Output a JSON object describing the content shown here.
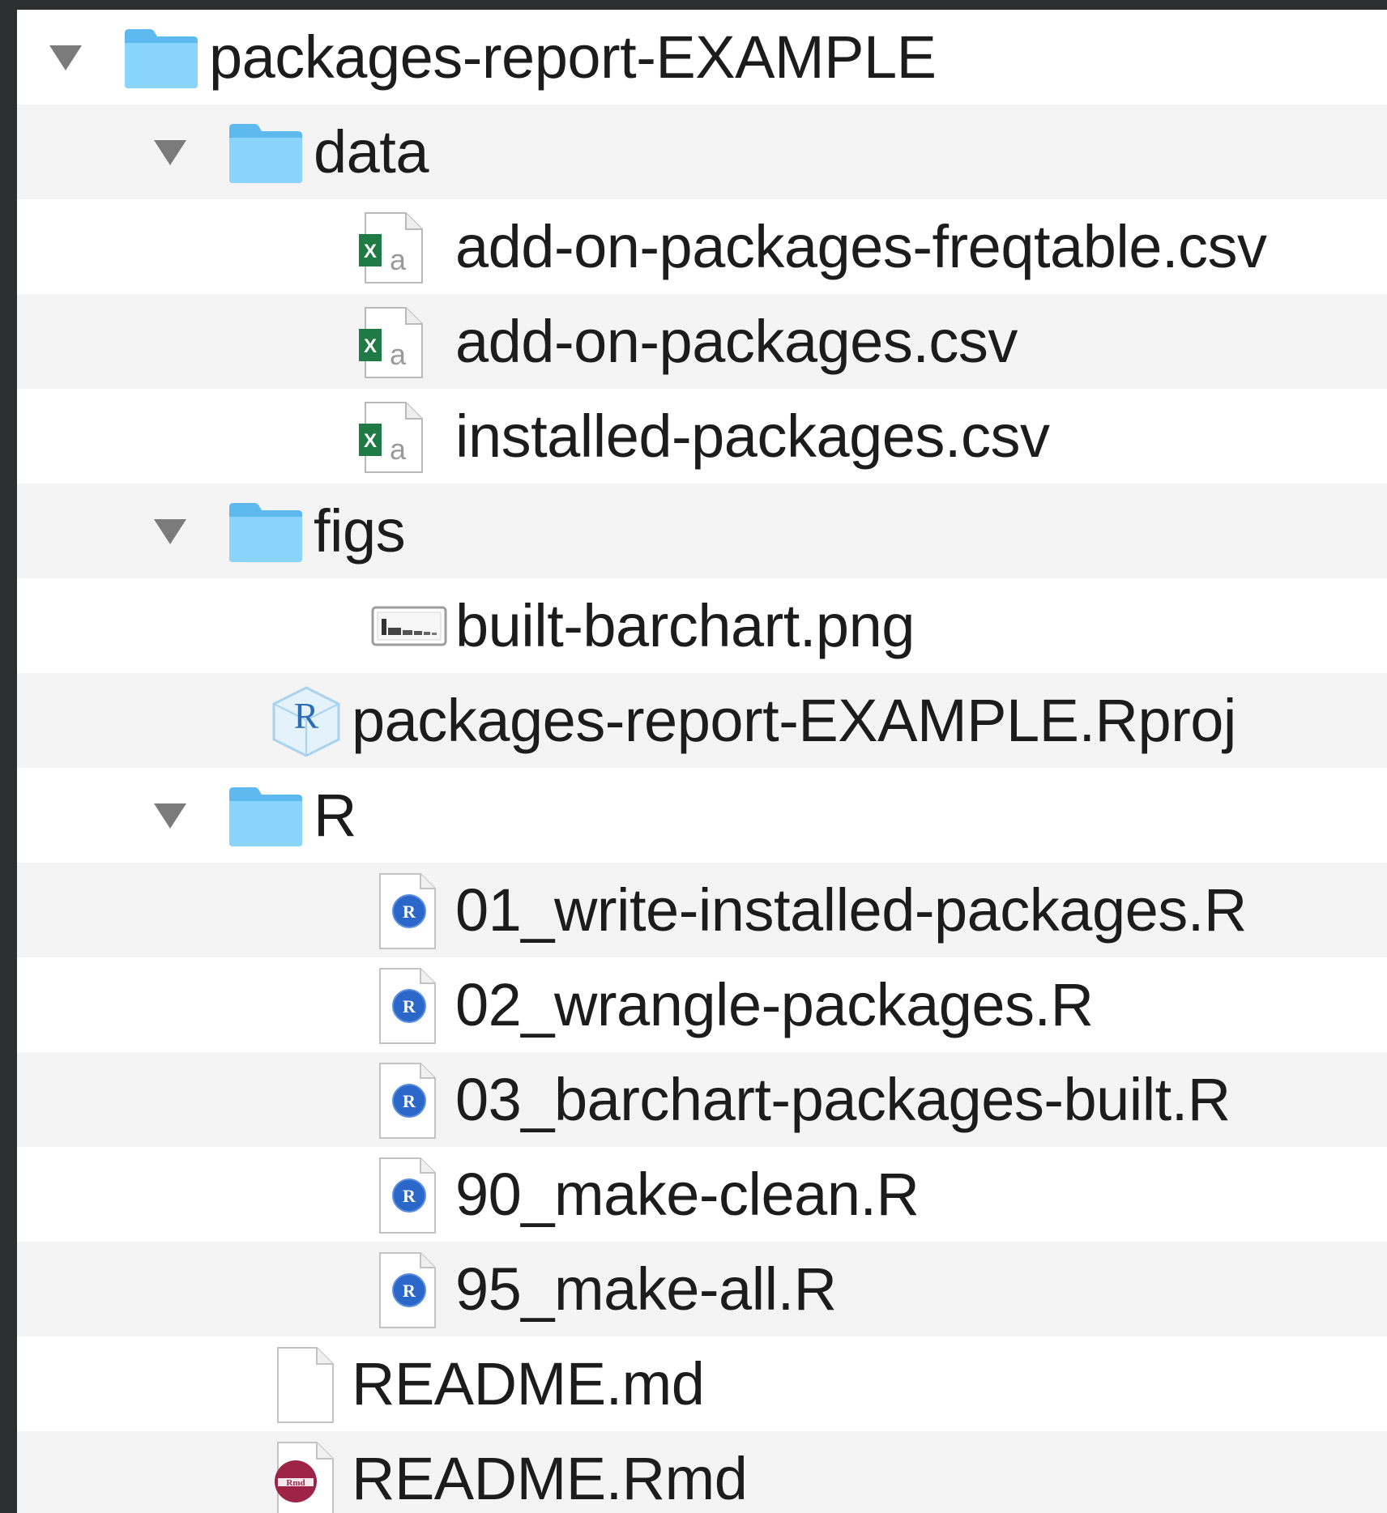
{
  "tree": {
    "root": {
      "name": "packages-report-EXAMPLE",
      "icon": "folder-icon",
      "expanded": true
    },
    "data_folder": {
      "name": "data",
      "icon": "folder-icon",
      "expanded": true,
      "files": [
        {
          "name": "add-on-packages-freqtable.csv",
          "icon": "csv-file-icon"
        },
        {
          "name": "add-on-packages.csv",
          "icon": "csv-file-icon"
        },
        {
          "name": "installed-packages.csv",
          "icon": "csv-file-icon"
        }
      ]
    },
    "figs_folder": {
      "name": "figs",
      "icon": "folder-icon",
      "expanded": true,
      "files": [
        {
          "name": "built-barchart.png",
          "icon": "png-file-icon"
        }
      ]
    },
    "rproj_file": {
      "name": "packages-report-EXAMPLE.Rproj",
      "icon": "rproj-file-icon"
    },
    "r_folder": {
      "name": "R",
      "icon": "folder-icon",
      "expanded": true,
      "files": [
        {
          "name": "01_write-installed-packages.R",
          "icon": "r-script-icon"
        },
        {
          "name": "02_wrangle-packages.R",
          "icon": "r-script-icon"
        },
        {
          "name": "03_barchart-packages-built.R",
          "icon": "r-script-icon"
        },
        {
          "name": "90_make-clean.R",
          "icon": "r-script-icon"
        },
        {
          "name": "95_make-all.R",
          "icon": "r-script-icon"
        }
      ]
    },
    "readme_md": {
      "name": "README.md",
      "icon": "text-file-icon"
    },
    "readme_rmd": {
      "name": "README.Rmd",
      "icon": "rmd-file-icon"
    }
  },
  "icon_glyphs": {
    "excel_letter": "X",
    "excel_sub": "a",
    "r_letter": "R",
    "rmd_letter": "Rmd"
  },
  "colors": {
    "background": "#2e2f30",
    "row_alt": "#f4f4f4",
    "row_plain": "#ffffff",
    "folder_blue": "#6cc3f2",
    "folder_blue_light": "#92d6fb",
    "excel_green": "#1f7a45",
    "r_blue": "#2b67c8",
    "rmd_maroon": "#9e2447",
    "text": "#1c1c1c",
    "disclosure_gray": "#7b7b7b"
  }
}
